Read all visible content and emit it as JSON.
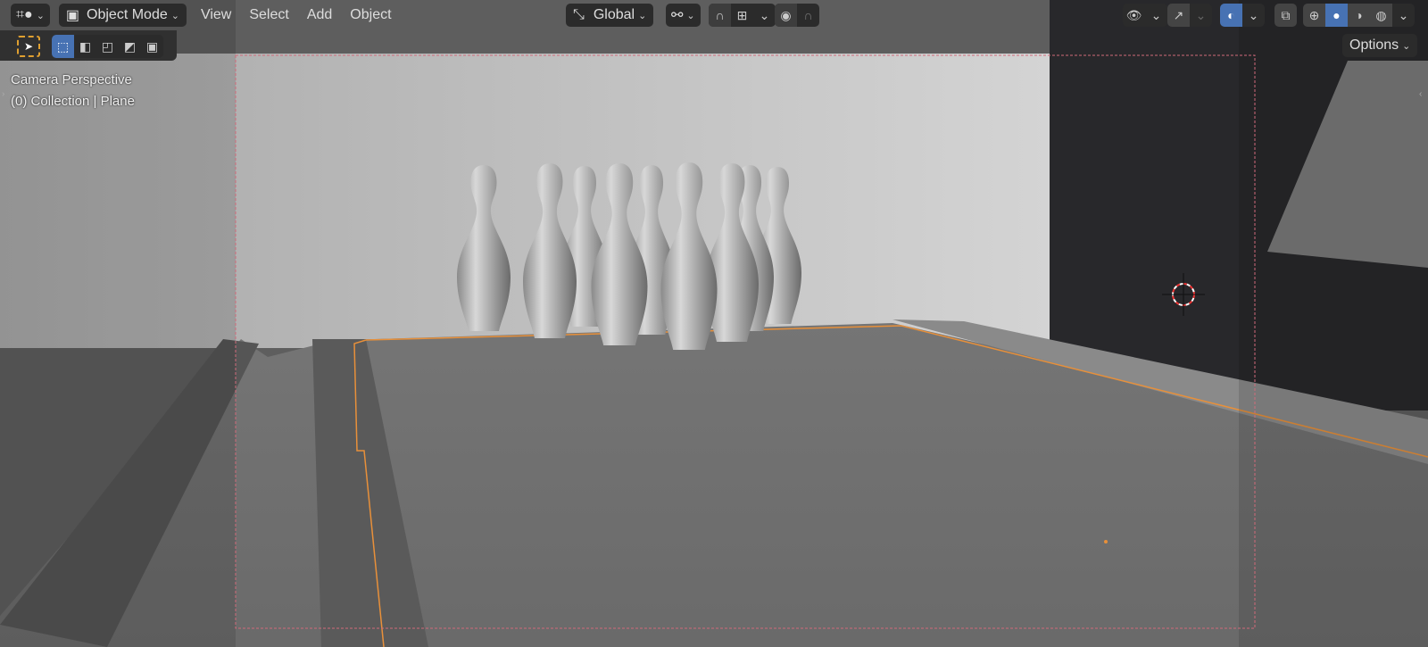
{
  "header": {
    "editor_type_icon": "viewport-editor-icon",
    "mode_label": "Object Mode",
    "menus": [
      "View",
      "Select",
      "Add",
      "Object"
    ],
    "transform_orientation": "Global",
    "options_label": "Options"
  },
  "viewport": {
    "view_name": "Camera Perspective",
    "collection_info": "(0) Collection | Plane"
  },
  "colors": {
    "accent": "#4772b3",
    "selection": "#e8903a",
    "frame": "#d06a7a"
  }
}
